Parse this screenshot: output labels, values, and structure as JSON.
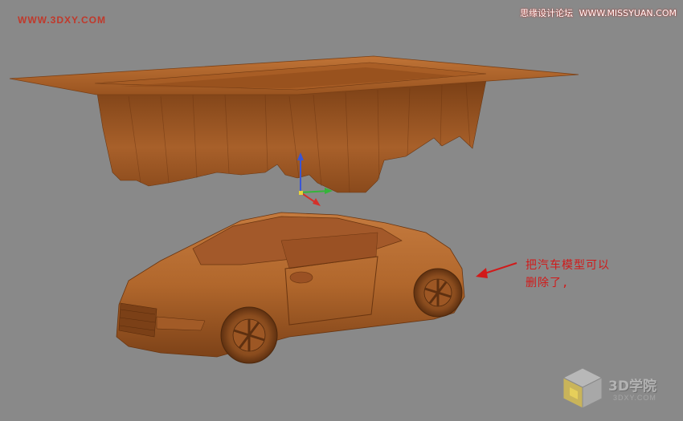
{
  "watermark": {
    "site_url": "WWW.3DXY.COM",
    "forum_name": "思缘设计论坛",
    "forum_url": "WWW.MISSYUAN.COM"
  },
  "annotation": {
    "line1": "把汽车模型可以",
    "line2": "删除了,"
  },
  "logo": {
    "name": "3D学院",
    "url": "3DXY.COM",
    "icon": "cube-logo-icon"
  },
  "colors": {
    "viewport_bg": "#898989",
    "model_orange": "#b5652a",
    "annotation_red": "#d11a1a",
    "gizmo_x": "#d4302a",
    "gizmo_y": "#35b43a",
    "gizmo_z": "#3a55d4"
  }
}
